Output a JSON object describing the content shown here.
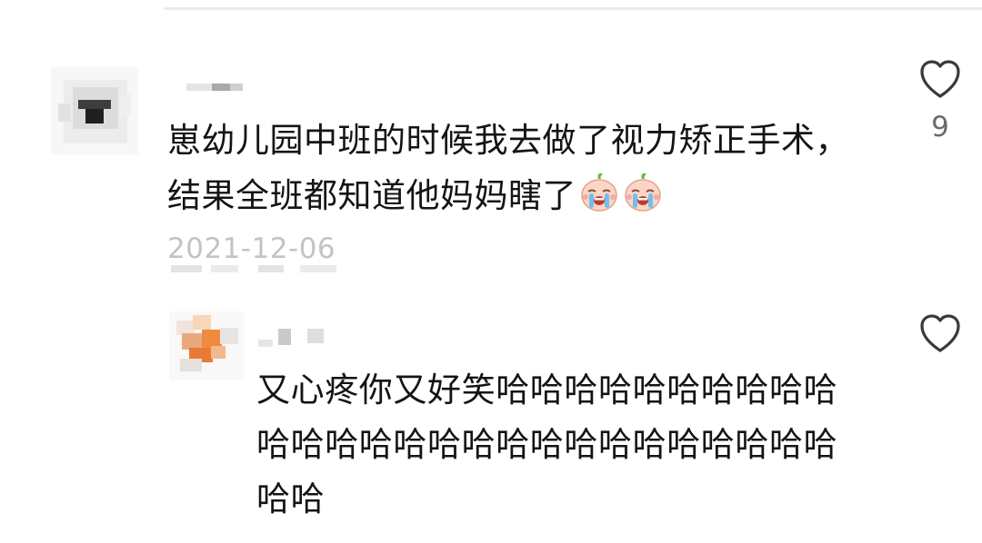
{
  "comment": {
    "text": "崽幼儿园中班的时候我去做了视力矫正手术，结果全班都知道他妈妈瞎了",
    "emojis": [
      "loudly-crying-peach-emoji",
      "loudly-crying-peach-emoji"
    ],
    "date": "2021-12-06",
    "like_count": "9",
    "like_icon": "heart-outline-icon"
  },
  "reply": {
    "text": "又心疼你又好笑哈哈哈哈哈哈哈哈哈哈哈哈哈哈哈哈哈哈哈哈哈哈哈哈哈哈哈哈哈",
    "like_icon": "heart-outline-icon"
  },
  "colors": {
    "text": "#141414",
    "date": "#c3c3c3",
    "like_count": "#6b6b6b",
    "heart_stroke": "#3a3a3a"
  }
}
